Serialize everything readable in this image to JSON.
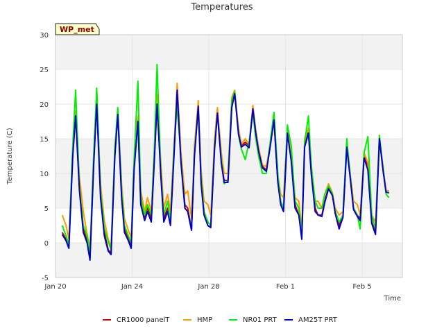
{
  "chart_data": {
    "type": "line",
    "title": "Temperatures",
    "xlabel": "Time",
    "ylabel": "Temperature (C)",
    "station_label": "WP_met",
    "xlim": [
      0,
      18.1
    ],
    "ylim": [
      -5,
      30
    ],
    "xticks": [
      {
        "value": 0,
        "label": "Jan 20"
      },
      {
        "value": 4,
        "label": "Jan 24"
      },
      {
        "value": 8,
        "label": "Jan 28"
      },
      {
        "value": 12,
        "label": "Feb 1"
      },
      {
        "value": 16,
        "label": "Feb 5"
      }
    ],
    "yticks": [
      -5,
      0,
      5,
      10,
      15,
      20,
      25,
      30
    ],
    "bands": [
      [
        -5,
        0
      ],
      [
        5,
        15
      ],
      [
        25,
        30
      ]
    ],
    "band_color": "#f2f2f2",
    "legend_position": "bottom",
    "series": [
      {
        "name": "CR1000 panelT",
        "color": "#cc0000",
        "x": [
          0.35,
          0.55,
          0.7,
          0.9,
          1.05,
          1.25,
          1.45,
          1.65,
          1.8,
          2.0,
          2.15,
          2.35,
          2.55,
          2.75,
          2.9,
          3.1,
          3.25,
          3.45,
          3.6,
          3.8,
          3.95,
          4.1,
          4.3,
          4.45,
          4.65,
          4.8,
          5.0,
          5.15,
          5.3,
          5.5,
          5.65,
          5.85,
          6.0,
          6.2,
          6.35,
          6.55,
          6.75,
          6.9,
          7.1,
          7.25,
          7.45,
          7.6,
          7.75,
          7.95,
          8.1,
          8.3,
          8.45,
          8.65,
          8.8,
          9.0,
          9.2,
          9.35,
          9.55,
          9.7,
          9.9,
          10.1,
          10.3,
          10.45,
          10.6,
          10.8,
          11.0,
          11.2,
          11.4,
          11.6,
          11.75,
          11.9,
          12.1,
          12.3,
          12.5,
          12.7,
          12.85,
          13.0,
          13.2,
          13.35,
          13.55,
          13.7,
          13.9,
          14.05,
          14.25,
          14.45,
          14.6,
          14.8,
          15.0,
          15.2,
          15.4,
          15.55,
          15.75,
          15.9,
          16.1,
          16.3,
          16.5,
          16.7,
          16.9,
          17.1,
          17.25,
          17.4
        ],
        "y": [
          1.5,
          0.5,
          -0.5,
          13,
          18.5,
          8,
          2,
          0.3,
          -2.2,
          12,
          20.5,
          7,
          1.5,
          -1,
          -1.5,
          13,
          18.7,
          7,
          2,
          0.5,
          -0.5,
          11,
          17.8,
          6,
          3.5,
          5,
          3.5,
          12,
          20.3,
          10,
          3.5,
          5,
          3,
          14,
          22.3,
          12,
          5.5,
          5,
          2,
          13,
          20,
          9,
          4.5,
          3,
          2.5,
          14,
          19,
          12,
          9,
          9,
          20,
          21.8,
          16,
          14,
          14.5,
          14,
          19.5,
          16,
          13.5,
          11,
          10.5,
          14,
          17.8,
          9,
          6,
          5,
          16,
          12,
          5.5,
          4,
          1,
          14,
          16,
          10,
          5,
          4,
          4,
          6,
          8,
          7,
          4.5,
          2.5,
          4,
          14,
          9,
          5,
          4,
          3.5,
          12.5,
          11,
          3,
          1.5,
          15,
          10.5,
          7.5,
          7.5
        ]
      },
      {
        "name": "HMP",
        "color": "#ff9900",
        "x": [
          0.35,
          0.55,
          0.7,
          0.9,
          1.05,
          1.25,
          1.45,
          1.65,
          1.8,
          2.0,
          2.15,
          2.35,
          2.55,
          2.75,
          2.9,
          3.1,
          3.25,
          3.45,
          3.6,
          3.8,
          3.95,
          4.1,
          4.3,
          4.45,
          4.65,
          4.8,
          5.0,
          5.15,
          5.3,
          5.5,
          5.65,
          5.85,
          6.0,
          6.2,
          6.35,
          6.55,
          6.75,
          6.9,
          7.1,
          7.25,
          7.45,
          7.6,
          7.75,
          7.95,
          8.1,
          8.3,
          8.45,
          8.65,
          8.8,
          9.0,
          9.2,
          9.35,
          9.55,
          9.7,
          9.9,
          10.1,
          10.3,
          10.45,
          10.6,
          10.8,
          11.0,
          11.2,
          11.4,
          11.6,
          11.75,
          11.9,
          12.1,
          12.3,
          12.5,
          12.7,
          12.85,
          13.0,
          13.2,
          13.35,
          13.55,
          13.7,
          13.9,
          14.05,
          14.25,
          14.45,
          14.6,
          14.8,
          15.0,
          15.2,
          15.4,
          15.55,
          15.75,
          15.9,
          16.1,
          16.3,
          16.5,
          16.7,
          16.9,
          17.1,
          17.25,
          17.4
        ],
        "y": [
          4,
          2.5,
          0.5,
          13.5,
          19,
          9.5,
          4.5,
          1.2,
          -0.8,
          13,
          21,
          8.5,
          3.2,
          0.5,
          -0.5,
          14,
          19.3,
          8.5,
          3.5,
          1.8,
          0.8,
          12,
          18.2,
          7.5,
          4.5,
          6.5,
          4.5,
          13,
          21.3,
          11.5,
          5,
          7,
          4.5,
          15,
          23,
          13,
          7,
          7.5,
          3.5,
          14,
          20.5,
          10.5,
          6,
          5.5,
          4,
          15,
          19.5,
          13,
          10,
          10,
          21,
          22,
          16.5,
          14.2,
          15,
          14.2,
          19.8,
          16.3,
          13.7,
          11.2,
          11,
          14.2,
          18,
          9.8,
          7,
          6.5,
          16.8,
          12.8,
          6.5,
          6,
          2,
          15,
          16.5,
          11,
          6,
          6,
          5,
          7,
          8.5,
          7.2,
          5,
          4,
          4.5,
          14.5,
          9.5,
          6,
          5.5,
          4,
          13,
          11.5,
          4,
          3,
          15.3,
          10.8,
          7.5,
          7.5
        ]
      },
      {
        "name": "NR01 PRT",
        "color": "#00ee00",
        "x": [
          0.35,
          0.55,
          0.7,
          0.9,
          1.05,
          1.25,
          1.45,
          1.65,
          1.8,
          2.0,
          2.15,
          2.35,
          2.55,
          2.75,
          2.9,
          3.1,
          3.25,
          3.45,
          3.6,
          3.8,
          3.95,
          4.1,
          4.3,
          4.45,
          4.65,
          4.8,
          5.0,
          5.15,
          5.3,
          5.5,
          5.65,
          5.85,
          6.0,
          6.2,
          6.35,
          6.55,
          6.75,
          6.9,
          7.1,
          7.25,
          7.45,
          7.6,
          7.75,
          7.95,
          8.1,
          8.3,
          8.45,
          8.65,
          8.8,
          9.0,
          9.2,
          9.35,
          9.55,
          9.7,
          9.9,
          10.1,
          10.3,
          10.45,
          10.6,
          10.8,
          11.0,
          11.2,
          11.4,
          11.6,
          11.75,
          11.9,
          12.1,
          12.3,
          12.5,
          12.7,
          12.85,
          13.0,
          13.2,
          13.35,
          13.55,
          13.7,
          13.9,
          14.05,
          14.25,
          14.45,
          14.6,
          14.8,
          15.0,
          15.2,
          15.4,
          15.55,
          15.75,
          15.9,
          16.1,
          16.3,
          16.5,
          16.7,
          16.9,
          17.1,
          17.25,
          17.4
        ],
        "y": [
          2.5,
          1,
          -0.3,
          14,
          22,
          8,
          2.5,
          1,
          -1.5,
          13,
          22.3,
          7.5,
          2,
          0.2,
          -1,
          13.5,
          19.5,
          7.5,
          2.5,
          1,
          0,
          12,
          23.3,
          6.5,
          4,
          5.5,
          4,
          13,
          25.7,
          10,
          4,
          6,
          3,
          14.5,
          19.7,
          12,
          5,
          4.5,
          2,
          13,
          19.2,
          9.5,
          4.5,
          3,
          2.5,
          14,
          18.5,
          12,
          8.5,
          9,
          20.5,
          21.8,
          15.5,
          13.5,
          12,
          14.5,
          18.7,
          15,
          12.5,
          10,
          10,
          14.5,
          18.8,
          10,
          6,
          5,
          17,
          14,
          6,
          5,
          1,
          14.5,
          18.3,
          11,
          6,
          5,
          5,
          7,
          8.2,
          7,
          4.5,
          3,
          4,
          15,
          9,
          5,
          4,
          2,
          13,
          15.3,
          4,
          2,
          15.5,
          10.5,
          7,
          6.5
        ]
      },
      {
        "name": "AM25T PRT",
        "color": "#0000cc",
        "x": [
          0.35,
          0.55,
          0.7,
          0.9,
          1.05,
          1.25,
          1.45,
          1.65,
          1.8,
          2.0,
          2.15,
          2.35,
          2.55,
          2.75,
          2.9,
          3.1,
          3.25,
          3.45,
          3.6,
          3.8,
          3.95,
          4.1,
          4.3,
          4.45,
          4.65,
          4.8,
          5.0,
          5.15,
          5.3,
          5.5,
          5.65,
          5.85,
          6.0,
          6.2,
          6.35,
          6.55,
          6.75,
          6.9,
          7.1,
          7.25,
          7.45,
          7.6,
          7.75,
          7.95,
          8.1,
          8.3,
          8.45,
          8.65,
          8.8,
          9.0,
          9.2,
          9.35,
          9.55,
          9.7,
          9.9,
          10.1,
          10.3,
          10.45,
          10.6,
          10.8,
          11.0,
          11.2,
          11.4,
          11.6,
          11.75,
          11.9,
          12.1,
          12.3,
          12.5,
          12.7,
          12.85,
          13.0,
          13.2,
          13.35,
          13.55,
          13.7,
          13.9,
          14.05,
          14.25,
          14.45,
          14.6,
          14.8,
          15.0,
          15.2,
          15.4,
          15.55,
          15.75,
          15.9,
          16.1,
          16.3,
          16.5,
          16.7,
          16.9,
          17.1,
          17.25,
          17.4
        ],
        "y": [
          1.2,
          0.3,
          -0.8,
          12.5,
          18.3,
          7.5,
          1.5,
          0,
          -2.5,
          11.5,
          20,
          6.5,
          1,
          -1.2,
          -1.7,
          12.5,
          18.5,
          6.5,
          1.5,
          0.3,
          -0.8,
          10.5,
          17.5,
          5.5,
          3.2,
          4.5,
          3,
          11.5,
          20,
          9.5,
          3,
          4.5,
          2.5,
          13.5,
          22,
          11.5,
          5,
          4.5,
          1.8,
          12.5,
          19.7,
          8.5,
          4,
          2.5,
          2.2,
          13.5,
          18.7,
          11.5,
          8.7,
          8.7,
          19.5,
          21.5,
          15.7,
          13.8,
          14.2,
          13.7,
          19.3,
          15.8,
          13.2,
          10.8,
          10.3,
          13.8,
          17.7,
          8.8,
          5.5,
          4.5,
          15.8,
          11.8,
          5,
          4,
          0.5,
          13.8,
          15.8,
          9.8,
          4.5,
          4,
          3.8,
          5.8,
          7.8,
          6.8,
          4.2,
          2,
          3.7,
          13.8,
          8.8,
          4.8,
          3.8,
          3.2,
          12.2,
          10.5,
          2.8,
          1.2,
          15,
          10.2,
          7.3,
          7.2
        ]
      }
    ]
  }
}
